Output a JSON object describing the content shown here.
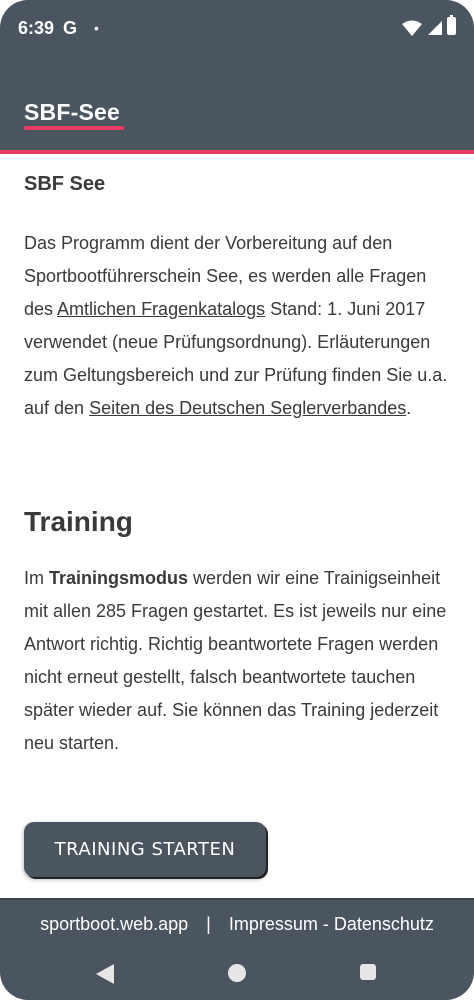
{
  "status_bar": {
    "time": "6:39",
    "g_icon": "G",
    "notification_dot": "•"
  },
  "app_bar": {
    "title": "SBF-See"
  },
  "intro": {
    "heading": "SBF See",
    "text_before_link1": "Das Programm dient der Vorbereitung auf den Sportbootführerschein See, es werden alle Fragen des ",
    "link1": "Amtlichen Fragenkatalogs",
    "text_after_link1": " Stand: 1. Juni 2017 verwendet (neue Prüfungsordnung). Erläuterungen zum Geltungsbereich und zur Prüfung finden Sie u.a. auf den ",
    "link2": "Seiten des Deutschen Seglerverbandes",
    "text_end": "."
  },
  "training": {
    "heading": "Training",
    "text_prefix": "Im ",
    "text_bold": "Trainingsmodus",
    "text_rest": " werden wir eine Trainigseinheit mit allen 285 Fragen gestartet. Es ist jeweils nur eine Antwort richtig. Richtig beantwortete Fragen werden nicht erneut gestellt, falsch beantwortete tauchen später wieder auf. Sie können das Training jederzeit neu starten.",
    "button_label": "TRAINING STARTEN"
  },
  "footer": {
    "site": "sportboot.web.app",
    "separator": "|",
    "legal": "Impressum - Datenschutz"
  },
  "colors": {
    "primary": "#4a5560",
    "accent": "#e83a64",
    "text": "#3a3a3a"
  },
  "icons": {
    "wifi": "wifi-icon",
    "signal": "cell-signal-icon",
    "battery": "battery-icon",
    "back": "back-triangle-icon",
    "home": "home-circle-icon",
    "recents": "recents-square-icon"
  }
}
